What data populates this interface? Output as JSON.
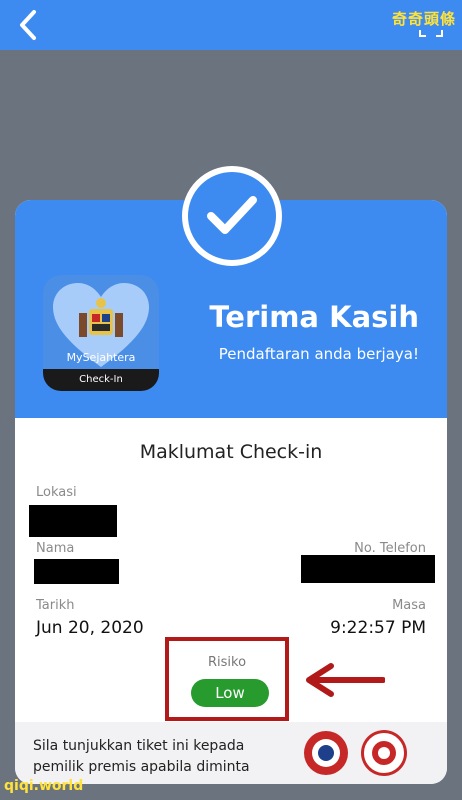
{
  "watermark": {
    "top": "奇奇頭條",
    "bottom": "qiqi.world"
  },
  "header": {
    "back_icon": "chevron-left-icon",
    "scan_icon": "scan-frame-icon"
  },
  "card": {
    "app": {
      "name": "MySejahtera",
      "badge": "Check-In"
    },
    "title": "Terima Kasih",
    "subtitle": "Pendaftaran anda berjaya!",
    "section_title": "Maklumat Check-in",
    "fields": {
      "location_label": "Lokasi",
      "name_label": "Nama",
      "phone_label": "No. Telefon",
      "date_label": "Tarikh",
      "date_value": "Jun 20, 2020",
      "time_label": "Masa",
      "time_value": "9:22:57 PM"
    },
    "risk": {
      "label": "Risiko",
      "value": "Low"
    },
    "footer_text": "Sila tunjukkan tiket ini kepada pemilik premis apabila diminta"
  },
  "colors": {
    "header_blue": "#3d8af0",
    "risk_green": "#279b2d",
    "annotation_red": "#b21a1a",
    "backdrop": "#6b737f"
  }
}
